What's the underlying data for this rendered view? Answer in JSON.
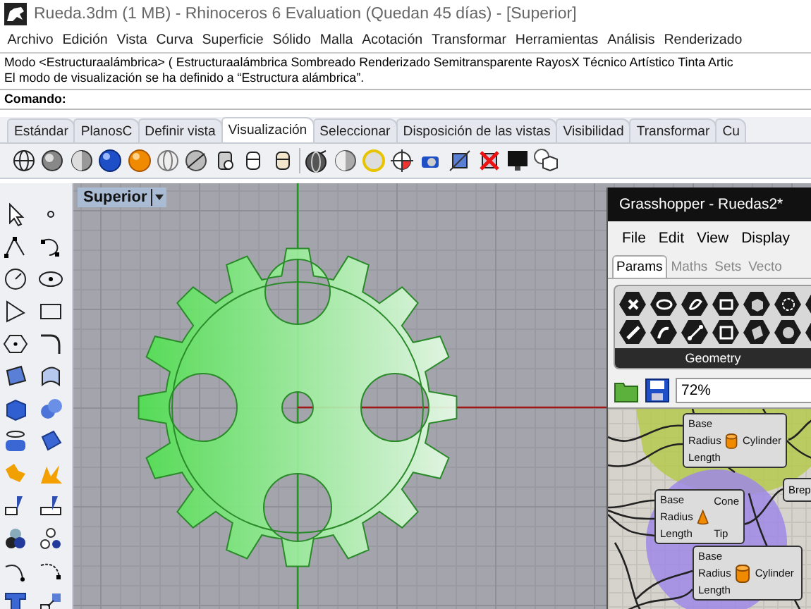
{
  "window": {
    "title": "Rueda.3dm (1 MB) - Rhinoceros 6 Evaluation (Quedan 45 días) - [Superior]"
  },
  "menu": [
    "Archivo",
    "Edición",
    "Vista",
    "Curva",
    "Superficie",
    "Sólido",
    "Malla",
    "Acotación",
    "Transformar",
    "Herramientas",
    "Análisis",
    "Renderizado"
  ],
  "command_history": [
    "Modo <Estructuraalámbrica> ( Estructuraalámbrica Sombreado Renderizado Semitransparente RayosX Técnico Artístico Tinta Artic",
    "El modo de visualización se ha definido a “Estructura alámbrica”."
  ],
  "command_prompt": "Comando:",
  "toolbar_tabs": [
    {
      "label": "Estándar",
      "selected": false
    },
    {
      "label": "PlanosC",
      "selected": false
    },
    {
      "label": "Definir vista",
      "selected": false
    },
    {
      "label": "Visualización",
      "selected": true
    },
    {
      "label": "Seleccionar",
      "selected": false
    },
    {
      "label": "Disposición de las vistas",
      "selected": false
    },
    {
      "label": "Visibilidad",
      "selected": false
    },
    {
      "label": "Transformar",
      "selected": false
    },
    {
      "label": "Cu",
      "selected": false
    }
  ],
  "viewport": {
    "title": "Superior"
  },
  "grasshopper": {
    "title": "Grasshopper - Ruedas2*",
    "menu": [
      "File",
      "Edit",
      "View",
      "Display"
    ],
    "tabs": [
      {
        "label": "Params",
        "selected": true
      },
      {
        "label": "Maths",
        "selected": false
      },
      {
        "label": "Sets",
        "selected": false
      },
      {
        "label": "Vecto",
        "selected": false
      }
    ],
    "panel_label": "Geometry",
    "zoom": "72%",
    "nodes": [
      {
        "kind": "cylinder",
        "inputs": [
          "Base",
          "Radius",
          "Length"
        ],
        "outputs": [
          "Cylinder"
        ]
      },
      {
        "kind": "param",
        "outputs": [
          "Brep"
        ]
      },
      {
        "kind": "cone",
        "inputs": [
          "Base",
          "Radius",
          "Length"
        ],
        "outputs": [
          "Cone",
          "Tip"
        ]
      },
      {
        "kind": "cylinder",
        "inputs": [
          "Base",
          "Radius",
          "Length"
        ],
        "outputs": [
          "Cylinder"
        ]
      }
    ]
  }
}
